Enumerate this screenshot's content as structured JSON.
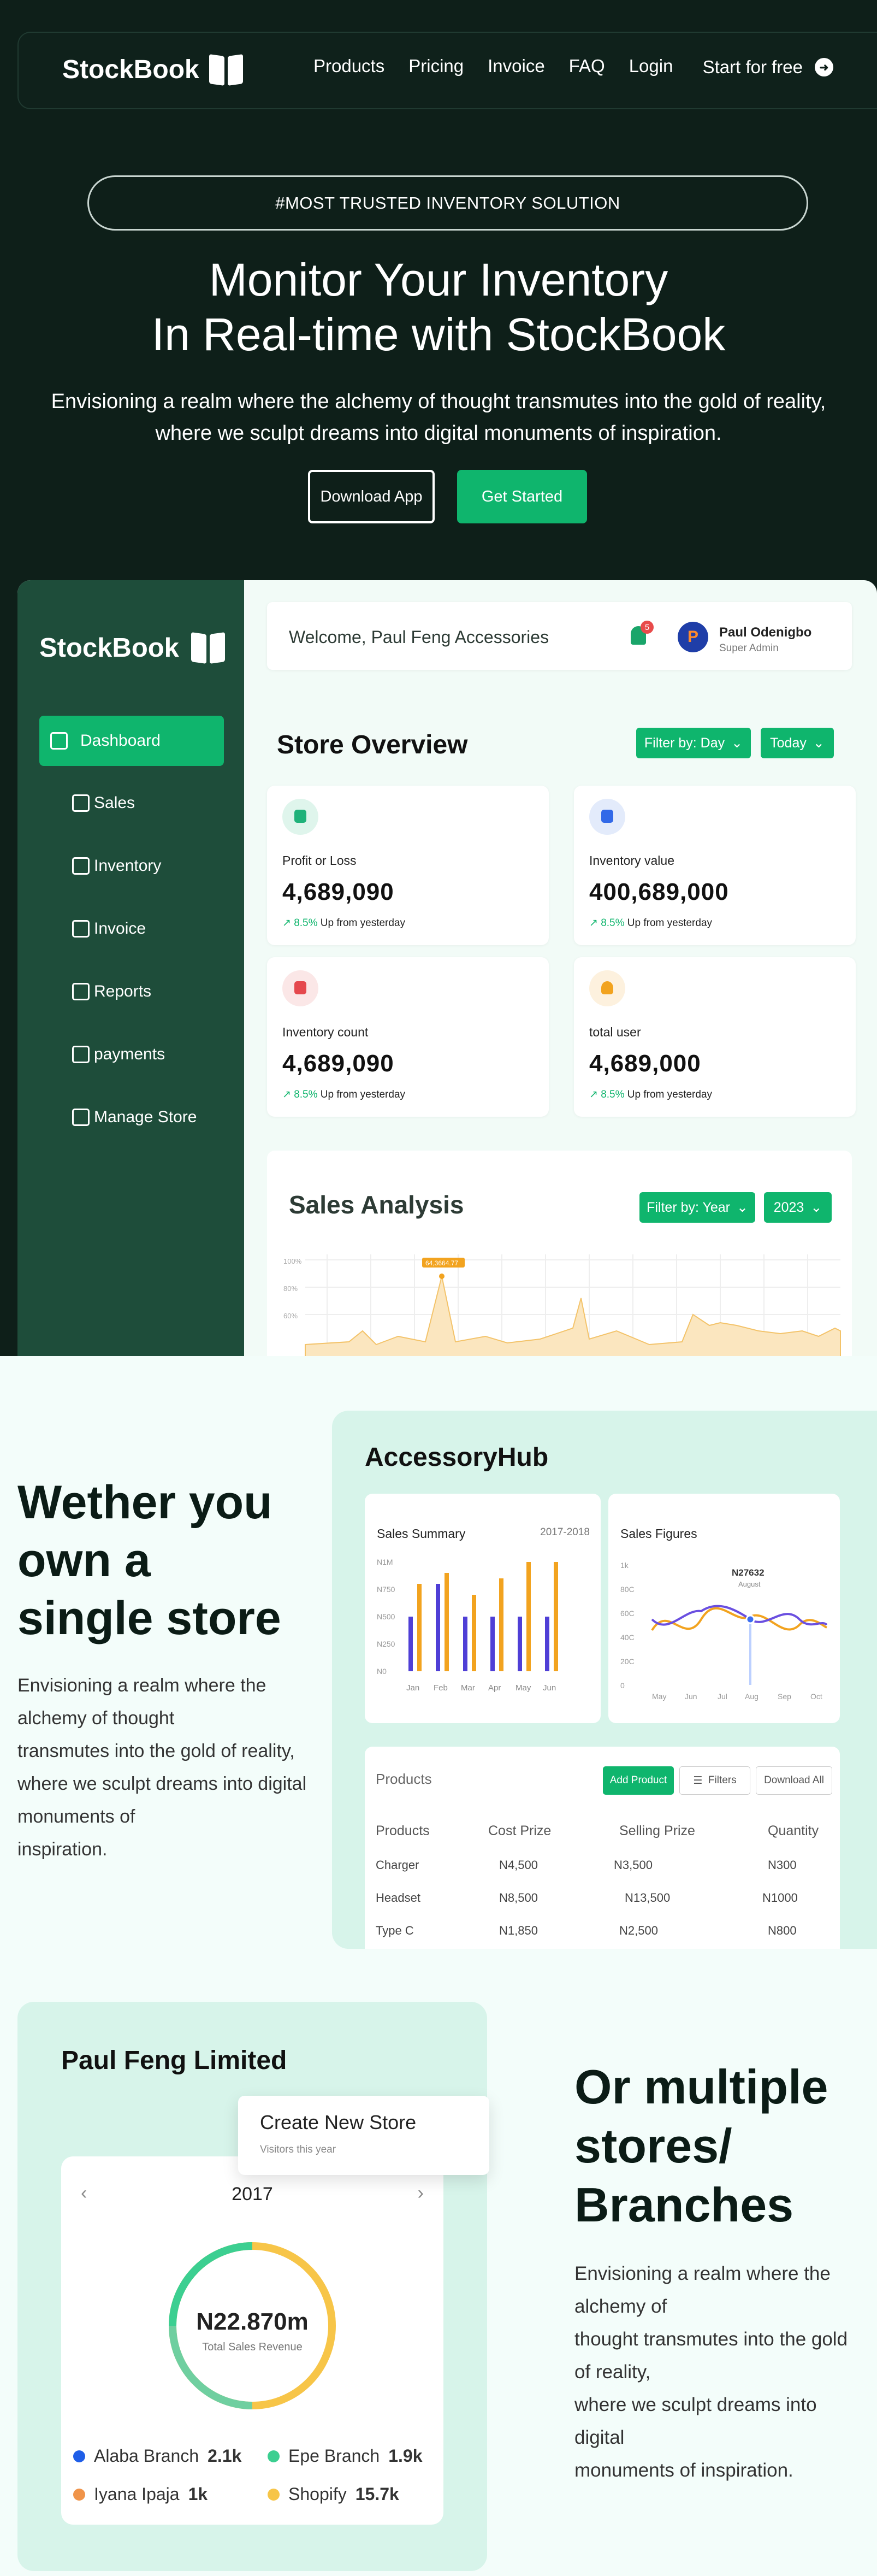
{
  "brand": "StockBook",
  "nav": {
    "links": [
      "Products",
      "Pricing",
      "Invoice",
      "FAQ",
      "Login"
    ],
    "cta": "Start for free"
  },
  "hero": {
    "badge": "#MOST TRUSTED INVENTORY SOLUTION",
    "title_line1": "Monitor Your Inventory",
    "title_line2": "In Real-time with StockBook",
    "subtitle_line1": "Envisioning a realm where the alchemy of thought transmutes into the gold of reality,",
    "subtitle_line2": "where we sculpt dreams into digital monuments of inspiration.",
    "btn_download": "Download App",
    "btn_start": "Get Started"
  },
  "dashboard": {
    "sidebar": [
      "Dashboard",
      "Sales",
      "Inventory",
      "Invoice",
      "Reports",
      "payments",
      "Manage Store"
    ],
    "welcome": "Welcome, Paul Feng Accessories",
    "notif_count": "5",
    "user": {
      "name": "Paul Odenigbo",
      "role": "Super Admin",
      "initial": "P"
    },
    "overview_title": "Store Overview",
    "filter_day": "Filter by: Day",
    "filter_today": "Today",
    "cards": [
      {
        "label": "Profit or Loss",
        "value": "4,689,090",
        "pct": "8.5%",
        "change": "Up from yesterday",
        "color": "#1fb27a",
        "bg": "#dff5ec"
      },
      {
        "label": "Inventory value",
        "value": "400,689,000",
        "pct": "8.5%",
        "change": "Up from yesterday",
        "color": "#3269e8",
        "bg": "#e3ebfb"
      },
      {
        "label": "Inventory count",
        "value": "4,689,090",
        "pct": "8.5%",
        "change": "Up from yesterday",
        "color": "#e5484d",
        "bg": "#fbe7e7"
      },
      {
        "label": "total user",
        "value": "4,689,000",
        "pct": "8.5%",
        "change": "Up from yesterday",
        "color": "#f2a31f",
        "bg": "#fdf1de"
      }
    ],
    "sales_title": "Sales Analysis",
    "filter_year": "Filter by: Year",
    "year": "2023",
    "sales_ticks": [
      "100%",
      "80%",
      "60%"
    ],
    "sales_tooltip": "64,3664.77"
  },
  "accessory": {
    "heading": [
      "Wether you",
      "own a",
      "single store"
    ],
    "para": [
      "Envisioning a realm where the",
      "alchemy of thought",
      "transmutes into the gold of reality,",
      "where we sculpt dreams into digital",
      "monuments of",
      "inspiration."
    ],
    "panel_title": "AccessoryHub",
    "summary": {
      "title": "Sales Summary",
      "range": "2017-2018",
      "yticks": [
        "N1M",
        "N750",
        "N500",
        "N250",
        "N0"
      ],
      "months": [
        "Jan",
        "Feb",
        "Mar",
        "Apr",
        "May",
        "Jun"
      ]
    },
    "figures": {
      "title": "Sales Figures",
      "yticks": [
        "1k",
        "80C",
        "60C",
        "40C",
        "20C",
        "0"
      ],
      "months": [
        "May",
        "Jun",
        "Jul",
        "Aug",
        "Sep",
        "Oct"
      ],
      "tooltip_value": "N27632",
      "tooltip_month": "August"
    },
    "products": {
      "title": "Products",
      "add": "Add Product",
      "filters": "Filters",
      "download": "Download All",
      "headers": [
        "Products",
        "Cost Prize",
        "Selling Prize",
        "Quantity"
      ],
      "rows": [
        [
          "Charger",
          "N4,500",
          "N3,500",
          "N300"
        ],
        [
          "Headset",
          "N8,500",
          "N13,500",
          "N1000"
        ],
        [
          "Type C",
          "N1,850",
          "N2,500",
          "N800"
        ]
      ]
    }
  },
  "branches": {
    "panel_title": "Paul Feng Limited",
    "popup_title": "Create New Store",
    "popup_sub": "Visitors this year",
    "year": "2017",
    "total": "N22.870m",
    "total_label": "Total Sales Revenue",
    "legend": [
      {
        "name": "Alaba Branch",
        "value": "2.1k",
        "color": "#1f5ee8"
      },
      {
        "name": "Epe Branch",
        "value": "1.9k",
        "color": "#3ccf91"
      },
      {
        "name": "Iyana Ipaja",
        "value": "1k",
        "color": "#f0944a"
      },
      {
        "name": "Shopify",
        "value": "15.7k",
        "color": "#f7c548"
      }
    ],
    "heading": [
      "Or multiple",
      "stores/",
      "Branches"
    ],
    "para": [
      "Envisioning a realm where the",
      "alchemy of",
      "thought transmutes into the gold",
      "of reality,",
      "where we sculpt dreams into",
      "digital",
      "monuments of inspiration."
    ]
  },
  "colors": {
    "dark": "#0e1f19",
    "green": "#0fb56d",
    "sidebar": "#1e4d3a",
    "panel": "#d7f4ea"
  }
}
